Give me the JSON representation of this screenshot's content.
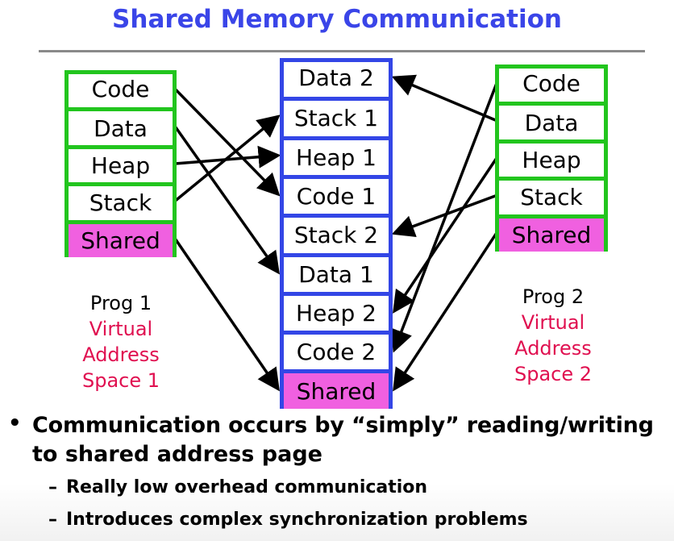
{
  "title": "Shared Memory Communication",
  "colors": {
    "title": "#3a45e8",
    "prog_border": "#22c51e",
    "phys_border": "#3346e6",
    "shared_fill": "#f060e0",
    "vas_text": "#e01050",
    "rule": "#8a8a8a"
  },
  "prog1": {
    "segments": [
      "Code",
      "Data",
      "Heap",
      "Stack",
      "Shared"
    ],
    "label_line1": "Prog 1",
    "label_line2": "Virtual",
    "label_line3": "Address",
    "label_line4": "Space 1"
  },
  "physical": {
    "segments": [
      "Data 2",
      "Stack 1",
      "Heap 1",
      "Code 1",
      "Stack 2",
      "Data 1",
      "Heap 2",
      "Code 2",
      "Shared"
    ]
  },
  "prog2": {
    "segments": [
      "Code",
      "Data",
      "Heap",
      "Stack",
      "Shared"
    ],
    "label_line1": "Prog 2",
    "label_line2": "Virtual",
    "label_line3": "Address",
    "label_line4": "Space 2"
  },
  "mappings": [
    {
      "from": "prog1",
      "seg": 0,
      "to": 3
    },
    {
      "from": "prog1",
      "seg": 1,
      "to": 5
    },
    {
      "from": "prog1",
      "seg": 2,
      "to": 2
    },
    {
      "from": "prog1",
      "seg": 3,
      "to": 1
    },
    {
      "from": "prog1",
      "seg": 4,
      "to": 8
    },
    {
      "from": "prog2",
      "seg": 0,
      "to": 7
    },
    {
      "from": "prog2",
      "seg": 1,
      "to": 0
    },
    {
      "from": "prog2",
      "seg": 2,
      "to": 6
    },
    {
      "from": "prog2",
      "seg": 3,
      "to": 4
    },
    {
      "from": "prog2",
      "seg": 4,
      "to": 8
    }
  ],
  "bullets": {
    "main_line1": "Communication occurs by “simply” reading/writing",
    "main_line2": "to shared address page",
    "sub1": "Really low overhead communication",
    "sub2": "Introduces complex synchronization problems",
    "bullet_glyph": "•",
    "dash_glyph": "–"
  }
}
